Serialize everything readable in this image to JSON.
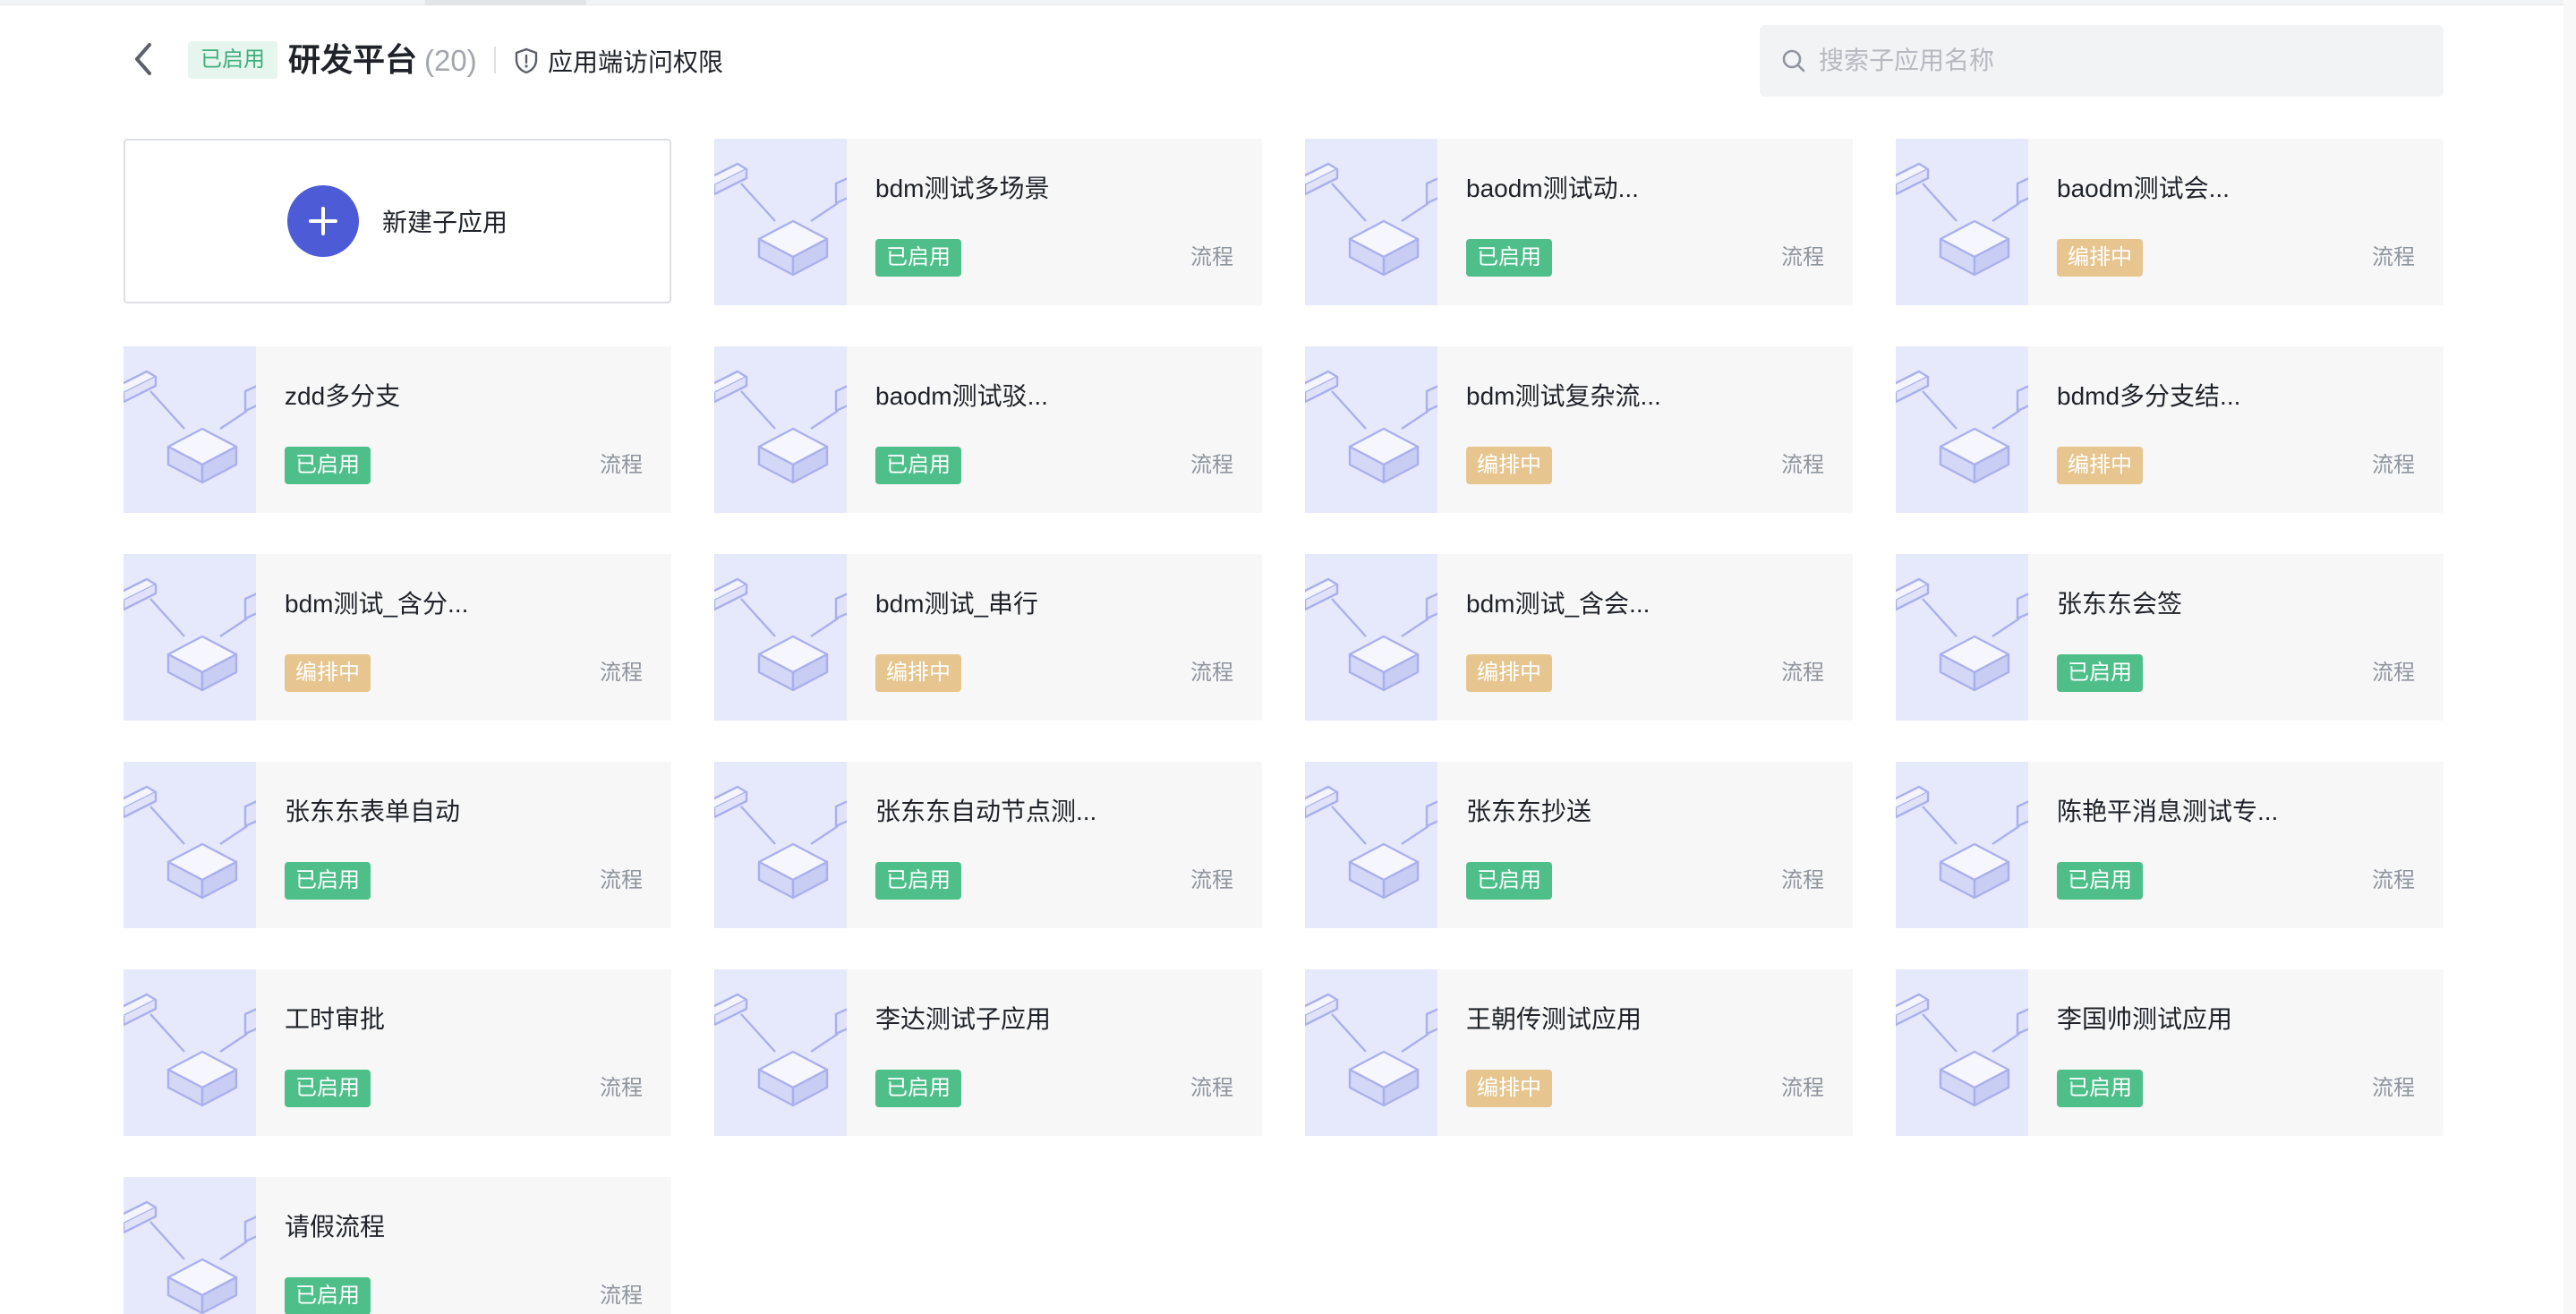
{
  "header": {
    "status": "已启用",
    "title": "研发平台",
    "count": "(20)",
    "access_link": "应用端访问权限"
  },
  "search": {
    "placeholder": "搜索子应用名称"
  },
  "new_app": {
    "label": "新建子应用"
  },
  "apps": [
    {
      "name": "bdm测试多场景",
      "status": "已启用",
      "status_key": "enabled",
      "type": "流程"
    },
    {
      "name": "baodm测试动...",
      "status": "已启用",
      "status_key": "enabled",
      "type": "流程"
    },
    {
      "name": "baodm测试会...",
      "status": "编排中",
      "status_key": "editing",
      "type": "流程"
    },
    {
      "name": "zdd多分支",
      "status": "已启用",
      "status_key": "enabled",
      "type": "流程"
    },
    {
      "name": "baodm测试驳...",
      "status": "已启用",
      "status_key": "enabled",
      "type": "流程"
    },
    {
      "name": "bdm测试复杂流...",
      "status": "编排中",
      "status_key": "editing",
      "type": "流程"
    },
    {
      "name": "bdmd多分支结...",
      "status": "编排中",
      "status_key": "editing",
      "type": "流程"
    },
    {
      "name": "bdm测试_含分...",
      "status": "编排中",
      "status_key": "editing",
      "type": "流程"
    },
    {
      "name": "bdm测试_串行",
      "status": "编排中",
      "status_key": "editing",
      "type": "流程"
    },
    {
      "name": "bdm测试_含会...",
      "status": "编排中",
      "status_key": "editing",
      "type": "流程"
    },
    {
      "name": "张东东会签",
      "status": "已启用",
      "status_key": "enabled",
      "type": "流程"
    },
    {
      "name": "张东东表单自动",
      "status": "已启用",
      "status_key": "enabled",
      "type": "流程"
    },
    {
      "name": "张东东自动节点测...",
      "status": "已启用",
      "status_key": "enabled",
      "type": "流程"
    },
    {
      "name": "张东东抄送",
      "status": "已启用",
      "status_key": "enabled",
      "type": "流程"
    },
    {
      "name": "陈艳平消息测试专...",
      "status": "已启用",
      "status_key": "enabled",
      "type": "流程"
    },
    {
      "name": "工时审批",
      "status": "已启用",
      "status_key": "enabled",
      "type": "流程"
    },
    {
      "name": "李达测试子应用",
      "status": "已启用",
      "status_key": "enabled",
      "type": "流程"
    },
    {
      "name": "王朝传测试应用",
      "status": "编排中",
      "status_key": "editing",
      "type": "流程"
    },
    {
      "name": "李国帅测试应用",
      "status": "已启用",
      "status_key": "enabled",
      "type": "流程"
    },
    {
      "name": "请假流程",
      "status": "已启用",
      "status_key": "enabled",
      "type": "流程"
    }
  ],
  "colors": {
    "accent": "#4e5bd6",
    "enabled": "#4fbf8a",
    "editing": "#e7c58f",
    "thumb_bg": "#e6e8fb"
  },
  "icons": {
    "back": "chevron-left-icon",
    "access": "shield-icon",
    "search": "search-icon",
    "add": "plus-icon",
    "app_thumb": "flow-cube-icon"
  }
}
